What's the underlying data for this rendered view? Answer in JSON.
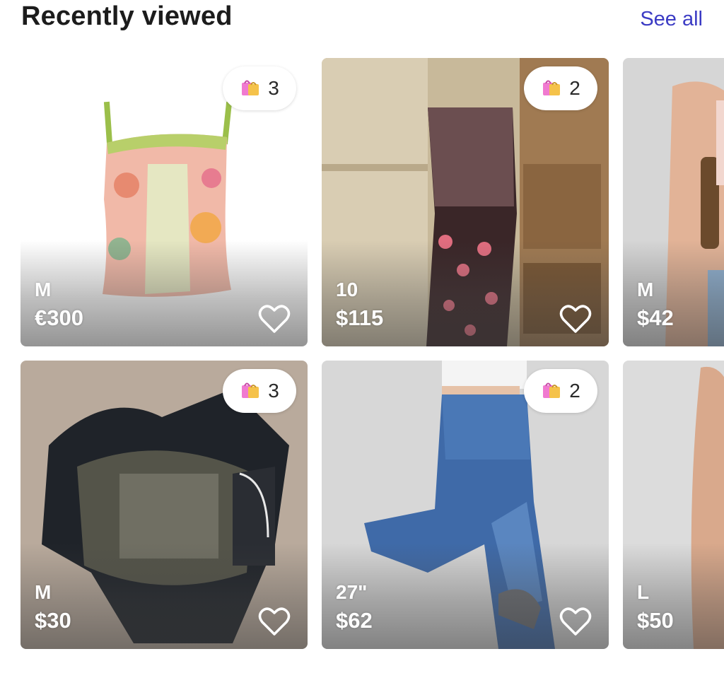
{
  "header": {
    "title": "Recently viewed",
    "see_all_label": "See all"
  },
  "items": [
    {
      "size": "M",
      "price": "€300",
      "bag_count": "3",
      "photo": "floral-satin-lace-corset-top"
    },
    {
      "size": "10",
      "price": "$115",
      "bag_count": "2",
      "photo": "brown-black-floral-slip-dress"
    },
    {
      "size": "M",
      "price": "$42",
      "bag_count": null,
      "photo": "model-with-shoulder-bag"
    },
    {
      "size": "M",
      "price": "$30",
      "bag_count": "3",
      "photo": "graphic-print-denim-jacket"
    },
    {
      "size": "27\"",
      "price": "$62",
      "bag_count": "2",
      "photo": "high-waist-flare-jeans"
    },
    {
      "size": "L",
      "price": "$50",
      "bag_count": null,
      "photo": "model-in-top"
    }
  ],
  "icons": {
    "bag": "shopping-bags-icon",
    "like": "heart-outline-icon"
  },
  "colors": {
    "accent": "#3b3bc4",
    "title": "#1c1c1c"
  }
}
